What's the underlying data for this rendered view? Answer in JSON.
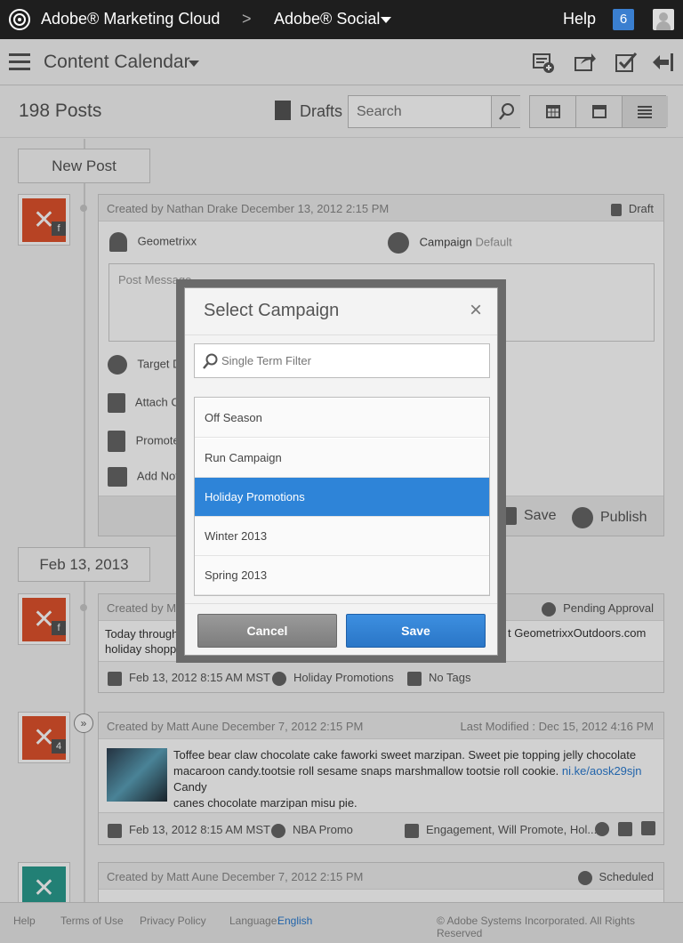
{
  "topbar": {
    "brand": "Adobe® Marketing Cloud",
    "separator": ">",
    "product": "Adobe® Social",
    "help": "Help",
    "notification_count": "6"
  },
  "subbar": {
    "title": "Content Calendar"
  },
  "toolbar": {
    "post_count": "198 Posts",
    "drafts_label": "Drafts",
    "search_placeholder": "Search"
  },
  "composer": {
    "new_post_label": "New Post",
    "created_by": "Created by Nathan Drake December 13, 2012 2:15 PM",
    "status": "Draft",
    "account": "Geometrixx",
    "campaign_label": "Campaign",
    "campaign_value": "Default",
    "post_message_placeholder": "Post Message",
    "target_label": "Target D",
    "attach_label": "Attach Co",
    "promote_label": "Promote",
    "add_note_label": "Add Note",
    "save_label": "Save",
    "publish_label": "Publish"
  },
  "date_group": {
    "date": "Feb 13, 2013"
  },
  "posts": [
    {
      "created_by": "Created by Matt",
      "status": "Pending Approval",
      "text": "Today through D",
      "text2": "holiday shoppin",
      "text_right": "t GeometrixxOutdoors.com",
      "date": "Feb 13, 2012 8:15 AM MST",
      "campaign": "Holiday Promotions",
      "tags": "No Tags"
    },
    {
      "created_by": "Created by Matt Aune December 7, 2012 2:15 PM",
      "last_modified": "Last Modified : Dec 15, 2012 4:16 PM",
      "count_badge": "4",
      "text1": "Toffee bear claw chocolate cake faworki sweet marzipan. Sweet pie topping jelly chocolate",
      "text2": "macaroon candy.tootsie roll sesame snaps marshmallow tootsie roll cookie.",
      "link": "ni.ke/aosk29sjn",
      "text2_after": " Candy",
      "text3": "canes chocolate marzipan misu pie.",
      "date": "Feb 13, 2012 8:15 AM MST",
      "campaign": "NBA Promo",
      "tags": "Engagement, Will Promote, Hol..."
    },
    {
      "created_by": "Created by Matt Aune December 7, 2012 2:15 PM",
      "status": "Scheduled"
    }
  ],
  "footer": {
    "help": "Help",
    "terms": "Terms of Use",
    "privacy": "Privacy Policy",
    "language_label": "Language:",
    "language_value": "English",
    "copyright": "© Adobe Systems Incorporated. All Rights Reserved"
  },
  "modal": {
    "title": "Select Campaign",
    "close": "×",
    "filter_placeholder": "Single Term Filter",
    "items": [
      "Off Season",
      "Run Campaign",
      "Holiday Promotions",
      "Winter 2013",
      "Spring 2013"
    ],
    "selected_item": "Holiday Promotions",
    "cancel_label": "Cancel",
    "save_label": "Save"
  },
  "colors": {
    "accent": "#2e84d8",
    "topbar": "#1e1e1e",
    "notif": "#3a7fd0",
    "brand_tile": "#e0522d"
  }
}
